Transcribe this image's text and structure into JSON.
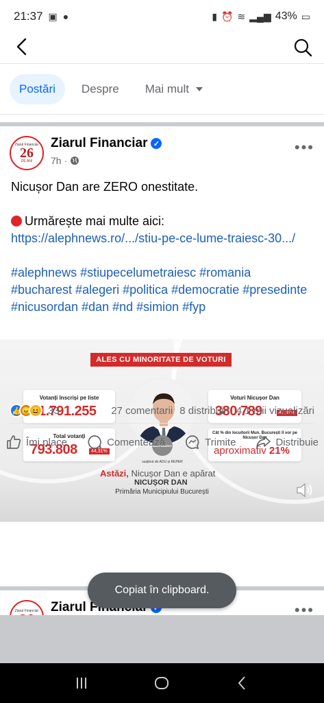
{
  "status_bar": {
    "time": "21:37",
    "battery": "43%"
  },
  "tabs": [
    {
      "label": "Postări",
      "active": true
    },
    {
      "label": "Despre",
      "active": false
    },
    {
      "label": "Mai mult",
      "active": false
    }
  ],
  "post": {
    "page_name": "Ziarul Financiar",
    "avatar_number": "26",
    "avatar_top": "Ziarul Financiar",
    "avatar_bottom": "DE ANI",
    "time": "7h",
    "text_line1": "Nicușor Dan are ZERO onestitate.",
    "text_line2": "Urmărește mai multe aici:",
    "link": "https://alephnews.ro/.../stiu-pe-ce-lume-traiesc-30.../",
    "hashtags": "#alephnews #stiupecelumetraiesc #romania #bucharest #alegeri #politica #democratie #presedinte #nicusordan #dan #nd #simion #fyp",
    "graphic": {
      "banner": "ALES CU MINORITATE DE VOTURI",
      "card1_label": "Votanți înscriși pe liste",
      "card1_value": "1.791.255",
      "card2_label": "Total votanți",
      "card2_value": "793.808",
      "card2_pct": "44,31%",
      "card3_label": "Voturi Nicușor Dan",
      "card3_value": "380.789",
      "card3_pct": "47,97%",
      "card4_label": "Cât % din locuitorii Mun. București îl vor pe Nicușor Dan",
      "card4_value_prefix": "aproximativ ",
      "card4_value": "21%",
      "badge": "INDEPENDENT",
      "support": "susținut de ADU și REPER",
      "caption_red": "Astăzi,",
      "caption_grey": " Nicușor Dan e apărat",
      "name": "NICUȘOR DAN",
      "subtitle": "Primăria Municipiului București"
    },
    "reactions_count": "33",
    "comments": "27 comentarii",
    "shares": "8 distribuiri",
    "views": "4,1 mii vizualizări",
    "actions": {
      "like": "Îmi place",
      "comment": "Comentează",
      "send": "Trimite",
      "share": "Distribuie"
    }
  },
  "toast": "Copiat în clipboard.",
  "post2": {
    "page_name": "Ziarul Financiar"
  }
}
